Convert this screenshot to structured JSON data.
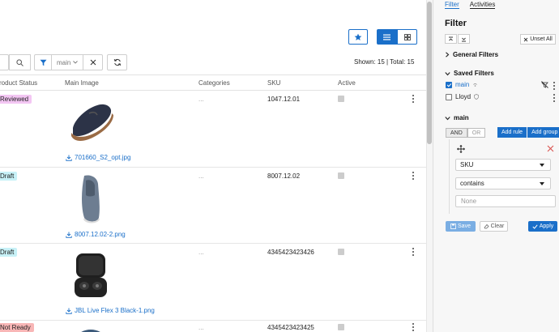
{
  "colors": {
    "accent": "#1a6fc9",
    "badge_reviewed": "#f3c6f3",
    "badge_draft": "#c7f1f7",
    "badge_not_ready": "#f8b6b6"
  },
  "toolbar": {
    "select_value": "main",
    "counts": "Shown: 15  |  Total: 15"
  },
  "table": {
    "columns": [
      "roduct Status",
      "Main Image",
      "Categories",
      "SKU",
      "Active"
    ],
    "rows": [
      {
        "status": "Reviewed",
        "file": "701660_S2_opt.jpg",
        "categories": "...",
        "sku": "1047.12.01"
      },
      {
        "status": "Draft",
        "file": "8007.12.02-2.png",
        "categories": "...",
        "sku": "8007.12.02"
      },
      {
        "status": "Draft",
        "file": "JBL Live Flex 3 Black-1.png",
        "categories": "...",
        "sku": "4345423423426"
      },
      {
        "status": "Not Ready",
        "file": "",
        "categories": "...",
        "sku": "4345423423425"
      }
    ]
  },
  "panel": {
    "tabs": [
      "Filter",
      "Activities"
    ],
    "title": "Filter",
    "unset_all": "Unset All",
    "general_filters": "General Filters",
    "saved_filters": "Saved Filters",
    "saved": [
      {
        "label": "main",
        "checked": true
      },
      {
        "label": "Lloyd",
        "checked": false
      }
    ],
    "group_title": "main",
    "and_label": "AND",
    "or_label": "OR",
    "add_rule": "Add rule",
    "add_group": "Add group",
    "field_value": "SKU",
    "operator_value": "contains",
    "value_placeholder": "None",
    "save": "Save",
    "clear": "Clear",
    "apply": "Apply"
  }
}
